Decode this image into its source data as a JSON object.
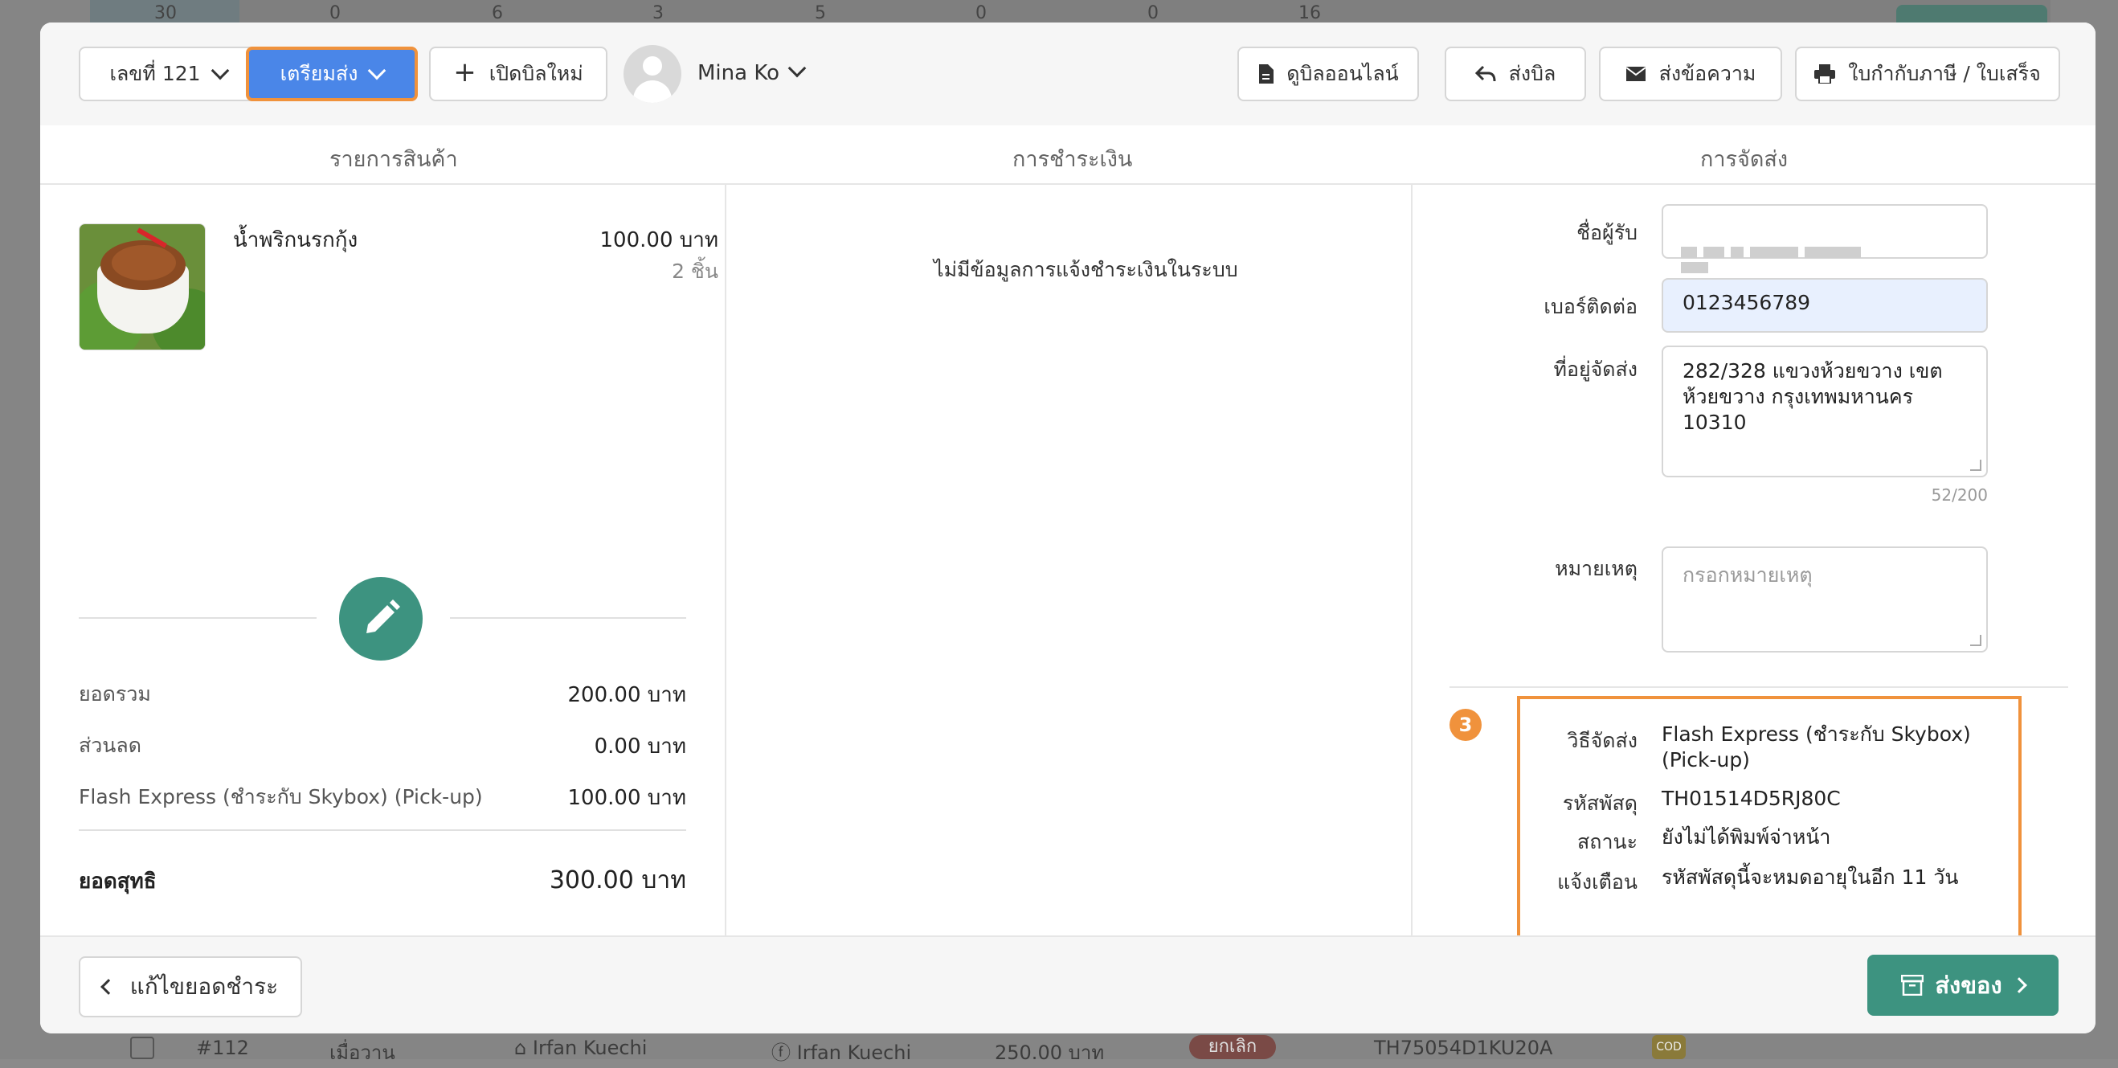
{
  "background": {
    "top_row": [
      "30",
      "0",
      "6",
      "3",
      "5",
      "0",
      "0",
      "16"
    ],
    "bottom_row": {
      "order_no": "#112",
      "date": "เมื่อวาน",
      "shop": "Irfan Kuechi",
      "customer": "Irfan Kuechi",
      "amount": "250.00 บาท",
      "status": "ยกเลิก",
      "tracking": "TH75054D1KU20A",
      "cod": "COD"
    }
  },
  "header": {
    "bill_number": "เลขที่ 121",
    "status_dropdown": "เตรียมส่ง",
    "new_bill": "เปิดบิลใหม่",
    "user_name": "Mina Ko",
    "view_online": "ดูบิลออนไลน์",
    "send_bill": "ส่งบิล",
    "send_message": "ส่งข้อความ",
    "tax_invoice": "ใบกำกับภาษี / ใบเสร็จ"
  },
  "columns": {
    "products": "รายการสินค้า",
    "payment": "การชำระเงิน",
    "shipping": "การจัดส่ง"
  },
  "product": {
    "name": "น้ำพริกนรกกุ้ง",
    "price": "100.00 บาท",
    "qty": "2 ชิ้น"
  },
  "summary": {
    "total_label": "ยอดรวม",
    "total_value": "200.00 บาท",
    "discount_label": "ส่วนลด",
    "discount_value": "0.00 บาท",
    "shipping_label": "Flash Express (ชำระกับ Skybox) (Pick-up)",
    "shipping_value": "100.00 บาท",
    "net_label": "ยอดสุทธิ",
    "net_value": "300.00 บาท"
  },
  "payment": {
    "empty_message": "ไม่มีข้อมูลการแจ้งชำระเงินในระบบ"
  },
  "shipping": {
    "recipient_label": "ชื่อผู้รับ",
    "phone_label": "เบอร์ติดต่อ",
    "phone_value": "0123456789",
    "address_label": "ที่อยู่จัดส่ง",
    "address_value": "282/328 แขวงห้วยขวาง เขตห้วยขวาง กรุงเทพมหานคร 10310",
    "char_count": "52/200",
    "note_label": "หมายเหตุ",
    "note_placeholder": "กรอกหมายเหตุ",
    "step_number": "3",
    "method_label": "วิธีจัดส่ง",
    "method_value_line1": "Flash Express (ชำระกับ Skybox)",
    "method_value_line2": "(Pick-up)",
    "tracking_label": "รหัสพัสดุ",
    "tracking_value": "TH01514D5RJ80C",
    "status_label": "สถานะ",
    "status_value": "ยังไม่ได้พิมพ์จ่าหน้า",
    "alert_label": "แจ้งเตือน",
    "alert_value": "รหัสพัสดุนี้จะหมดอายุในอีก 11 วัน"
  },
  "footer": {
    "back_label": "แก้ไขยอดชำระ",
    "ship_label": "ส่งของ"
  },
  "colors": {
    "primary_blue": "#4a86e8",
    "highlight_orange": "#f0923c",
    "teal": "#3d9380"
  }
}
